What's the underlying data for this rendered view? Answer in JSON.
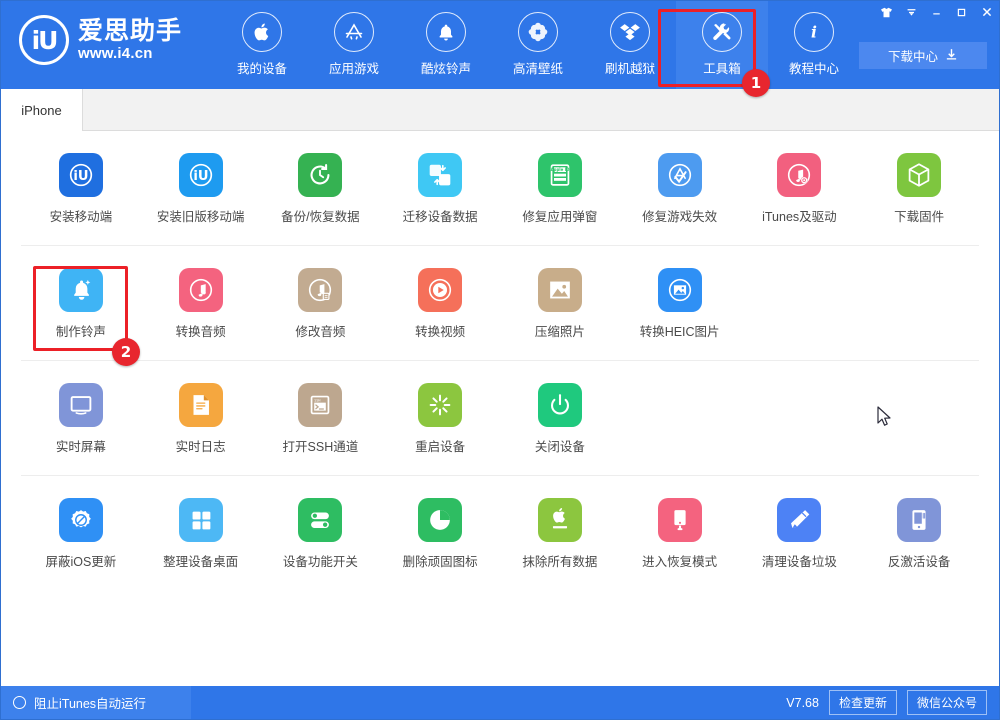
{
  "window": {
    "controls": [
      {
        "name": "skin-icon",
        "glyph": "skin"
      },
      {
        "name": "menu-icon",
        "glyph": "menu"
      },
      {
        "name": "minimize-icon",
        "glyph": "minimize"
      },
      {
        "name": "maximize-icon",
        "glyph": "maximize"
      },
      {
        "name": "close-icon",
        "glyph": "close"
      }
    ]
  },
  "brand": {
    "mark": "iU",
    "name_cn": "爱思助手",
    "url": "www.i4.cn"
  },
  "header": {
    "download_center": "下载中心",
    "nav": [
      {
        "label": "我的设备",
        "icon": "apple-icon",
        "active": false
      },
      {
        "label": "应用游戏",
        "icon": "appstore-icon",
        "active": false
      },
      {
        "label": "酷炫铃声",
        "icon": "bell-icon",
        "active": false
      },
      {
        "label": "高清壁纸",
        "icon": "flower-icon",
        "active": false
      },
      {
        "label": "刷机越狱",
        "icon": "box-open-icon",
        "active": false
      },
      {
        "label": "工具箱",
        "icon": "tools-icon",
        "active": true
      },
      {
        "label": "教程中心",
        "icon": "info-icon",
        "active": false
      }
    ]
  },
  "tabs": [
    {
      "label": "iPhone",
      "active": true
    }
  ],
  "annotations": [
    {
      "id": "1",
      "target": "工具箱"
    },
    {
      "id": "2",
      "target": "制作铃声"
    }
  ],
  "tools": {
    "rows": [
      {
        "items": [
          {
            "label": "安装移动端",
            "icon": "i4-app-icon",
            "color": "#1f6fe0",
            "highlighted": false
          },
          {
            "label": "安装旧版移动端",
            "icon": "i4-app-old-icon",
            "color": "#1e9bf0",
            "highlighted": false
          },
          {
            "label": "备份/恢复数据",
            "icon": "backup-restore-icon",
            "color": "#35b252",
            "highlighted": false
          },
          {
            "label": "迁移设备数据",
            "icon": "migrate-data-icon",
            "color": "#3fc8f4",
            "highlighted": false
          },
          {
            "label": "修复应用弹窗",
            "icon": "appleid-popup-icon",
            "color": "#2ec46b",
            "highlighted": false
          },
          {
            "label": "修复游戏失效",
            "icon": "fix-game-icon",
            "color": "#4d9bf0",
            "highlighted": false
          },
          {
            "label": "iTunes及驱动",
            "icon": "itunes-driver-icon",
            "color": "#f2607f",
            "highlighted": false
          },
          {
            "label": "下载固件",
            "icon": "firmware-icon",
            "color": "#7ec63f",
            "highlighted": false
          }
        ]
      },
      {
        "items": [
          {
            "label": "制作铃声",
            "icon": "make-ringtone-icon",
            "color": "#3fb4f5",
            "highlighted": true
          },
          {
            "label": "转换音频",
            "icon": "convert-audio-icon",
            "color": "#f4637f",
            "highlighted": false
          },
          {
            "label": "修改音频",
            "icon": "edit-audio-icon",
            "color": "#c2ab91",
            "highlighted": false
          },
          {
            "label": "转换视频",
            "icon": "convert-video-icon",
            "color": "#f5705a",
            "highlighted": false
          },
          {
            "label": "压缩照片",
            "icon": "compress-photo-icon",
            "color": "#c8ad8a",
            "highlighted": false
          },
          {
            "label": "转换HEIC图片",
            "icon": "convert-heic-icon",
            "color": "#2f90f5",
            "highlighted": false
          }
        ]
      },
      {
        "items": [
          {
            "label": "实时屏幕",
            "icon": "live-screen-icon",
            "color": "#8095d8",
            "highlighted": false
          },
          {
            "label": "实时日志",
            "icon": "live-log-icon",
            "color": "#f5a73f",
            "highlighted": false
          },
          {
            "label": "打开SSH通道",
            "icon": "ssh-tunnel-icon",
            "color": "#bda78f",
            "highlighted": false
          },
          {
            "label": "重启设备",
            "icon": "restart-device-icon",
            "color": "#8cc63f",
            "highlighted": false
          },
          {
            "label": "关闭设备",
            "icon": "power-off-icon",
            "color": "#1fc97e",
            "highlighted": false
          }
        ]
      },
      {
        "items": [
          {
            "label": "屏蔽iOS更新",
            "icon": "block-update-icon",
            "color": "#2f90f5",
            "highlighted": false
          },
          {
            "label": "整理设备桌面",
            "icon": "organize-desktop-icon",
            "color": "#4db8f5",
            "highlighted": false
          },
          {
            "label": "设备功能开关",
            "icon": "feature-toggle-icon",
            "color": "#2ebd62",
            "highlighted": false
          },
          {
            "label": "删除顽固图标",
            "icon": "delete-icon-icon",
            "color": "#2ebd62",
            "highlighted": false
          },
          {
            "label": "抹除所有数据",
            "icon": "erase-data-icon",
            "color": "#8cc63f",
            "highlighted": false
          },
          {
            "label": "进入恢复模式",
            "icon": "recovery-mode-icon",
            "color": "#f4637f",
            "highlighted": false
          },
          {
            "label": "清理设备垃圾",
            "icon": "clean-junk-icon",
            "color": "#4d82f5",
            "highlighted": false
          },
          {
            "label": "反激活设备",
            "icon": "deactivate-icon",
            "color": "#8095d8",
            "highlighted": false
          }
        ]
      }
    ]
  },
  "statusbar": {
    "block_itunes_label": "阻止iTunes自动运行",
    "version": "V7.68",
    "check_update": "检查更新",
    "wechat": "微信公众号"
  },
  "colors": {
    "header_blue": "#2f76e8",
    "accent_red": "#ec2027",
    "badge_red": "#e8262e"
  }
}
